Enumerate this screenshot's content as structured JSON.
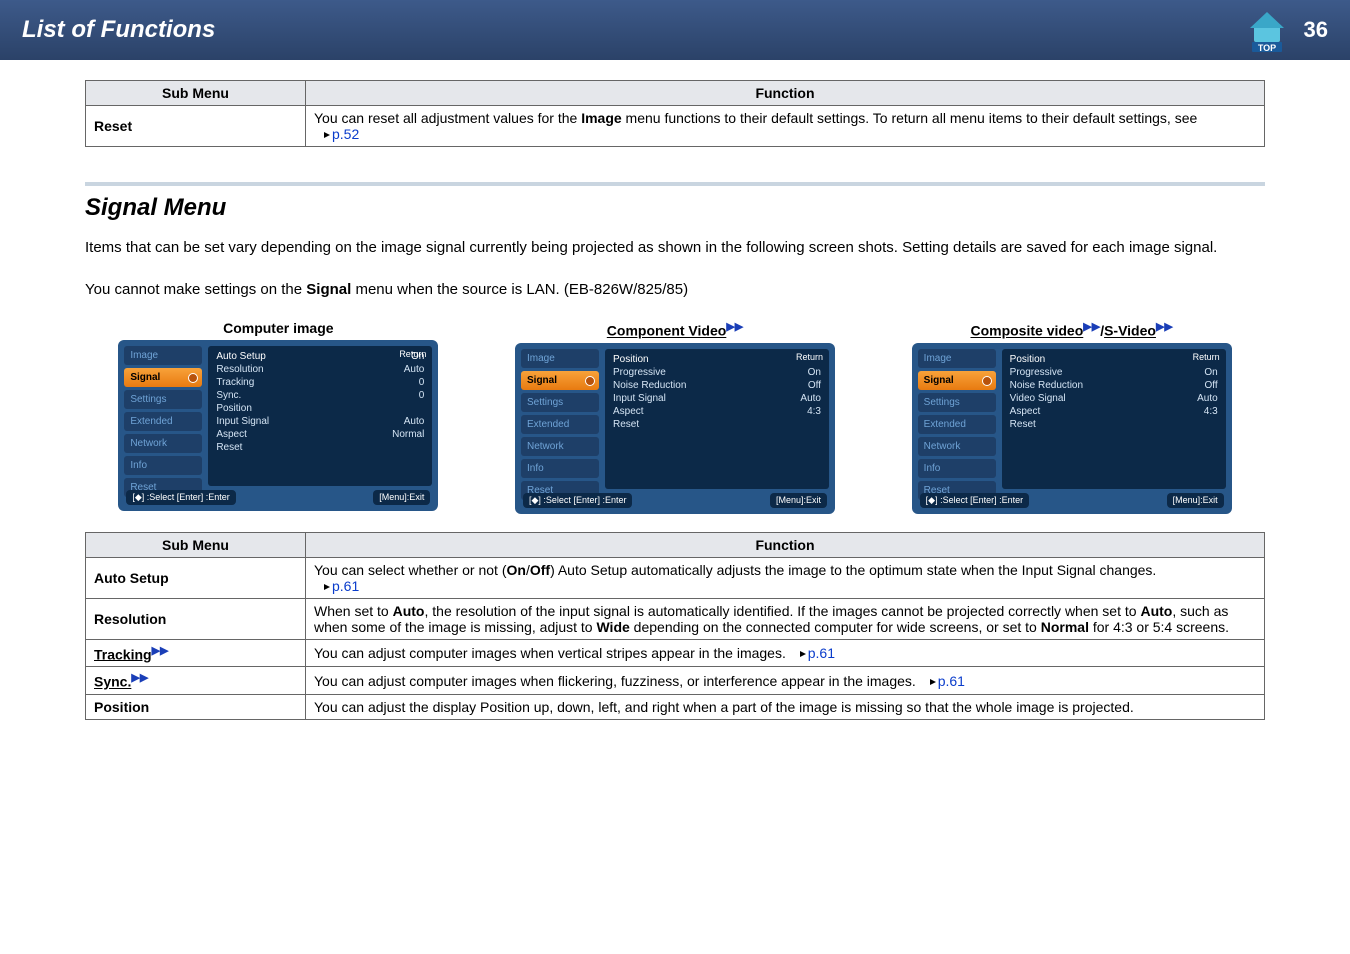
{
  "header": {
    "title": "List of Functions",
    "page_num": "36"
  },
  "table1": {
    "head_submenu": "Sub Menu",
    "head_function": "Function",
    "reset_label": "Reset",
    "reset_desc_a": "You can reset all adjustment values for the ",
    "reset_desc_b": "Image",
    "reset_desc_c": " menu functions to their default settings. To return all menu items to their default settings, see",
    "reset_ref": "p.52"
  },
  "section": {
    "title": "Signal Menu",
    "para1": "Items that can be set vary depending on the image signal currently being projected as shown in the following screen shots. Setting details are saved for each image signal.",
    "para2_a": "You cannot make settings on the ",
    "para2_b": "Signal",
    "para2_c": " menu when the source is LAN. (EB-826W/825/85)"
  },
  "shots": {
    "cap1": "Computer image",
    "cap2": "Component Video",
    "cap3a": "Composite video",
    "cap3b": "/",
    "cap3c": "S-Video"
  },
  "osd": {
    "tabs": {
      "image": "Image",
      "signal": "Signal",
      "settings": "Settings",
      "extended": "Extended",
      "network": "Network",
      "info": "Info",
      "reset": "Reset"
    },
    "return": "Return",
    "footer_left": "[◆] :Select  [Enter] :Enter",
    "footer_right": "[Menu]:Exit",
    "comp": {
      "r1l": "Auto Setup",
      "r1v": "On",
      "r2l": "Resolution",
      "r2v": "Auto",
      "r3l": "Tracking",
      "r3v": "0",
      "r4l": "Sync.",
      "r4v": "0",
      "r5l": "Position",
      "r5v": "",
      "r6l": "Input Signal",
      "r6v": "Auto",
      "r7l": "Aspect",
      "r7v": "Normal",
      "r8l": "Reset",
      "r8v": ""
    },
    "component": {
      "r1l": "Position",
      "r1v": "",
      "r2l": "Progressive",
      "r2v": "On",
      "r3l": "Noise Reduction",
      "r3v": "Off",
      "r4l": "Input Signal",
      "r4v": "Auto",
      "r5l": "Aspect",
      "r5v": "4:3",
      "r6l": "Reset",
      "r6v": ""
    },
    "composite": {
      "r1l": "Position",
      "r1v": "",
      "r2l": "Progressive",
      "r2v": "On",
      "r3l": "Noise Reduction",
      "r3v": "Off",
      "r4l": "Video Signal",
      "r4v": "Auto",
      "r5l": "Aspect",
      "r5v": "4:3",
      "r6l": "Reset",
      "r6v": ""
    }
  },
  "table2": {
    "head_submenu": "Sub Menu",
    "head_function": "Function",
    "rows": {
      "auto_setup": {
        "label": "Auto Setup",
        "d1": "You can select whether or not (",
        "d2": "On",
        "d3": "/",
        "d4": "Off",
        "d5": ") Auto Setup automatically adjusts the image to the optimum state when the Input Signal changes.",
        "ref": "p.61"
      },
      "resolution": {
        "label": "Resolution",
        "d1": "When set to ",
        "d2": "Auto",
        "d3": ", the resolution of the input signal is automatically identified. If the images cannot be projected correctly when set to ",
        "d4": "Auto",
        "d5": ", such as when some of the image is missing, adjust to ",
        "d6": "Wide",
        "d7": " depending on the connected computer for wide screens, or set to ",
        "d8": "Normal",
        "d9": " for 4:3 or 5:4 screens."
      },
      "tracking": {
        "label": "Tracking",
        "desc": "You can adjust computer images when vertical stripes appear in the images.",
        "ref": "p.61"
      },
      "sync": {
        "label": "Sync.",
        "desc": "You can adjust computer images when flickering, fuzziness, or interference appear in the images.",
        "ref": "p.61"
      },
      "position": {
        "label": "Position",
        "desc": "You can adjust the display Position up, down, left, and right when a part of the image is missing so that the whole image is projected."
      }
    }
  }
}
